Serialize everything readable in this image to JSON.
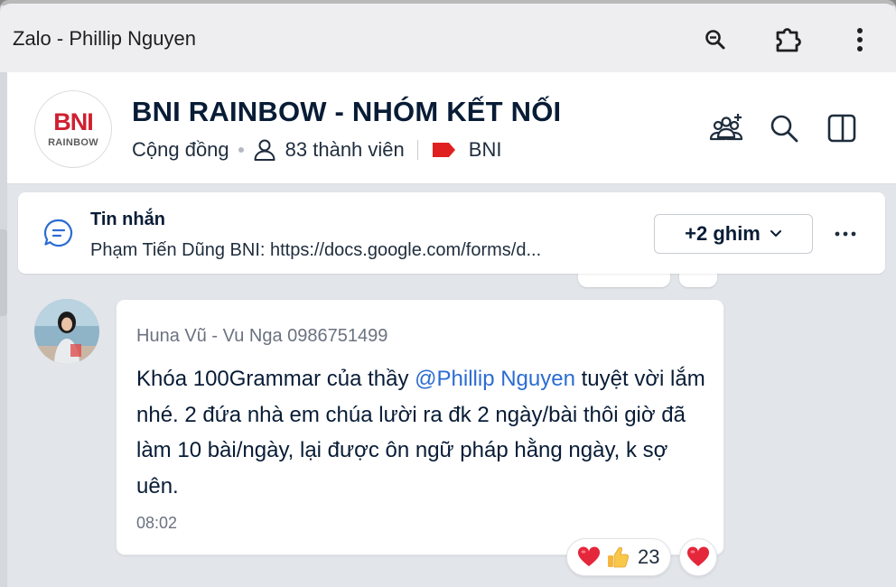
{
  "window": {
    "title": "Zalo - Phillip Nguyen",
    "zoom_icon": "zoom-out-icon",
    "extension_icon": "puzzle-icon",
    "menu_icon": "vertical-dots-icon"
  },
  "header": {
    "logo_text": "BNI",
    "logo_sub": "RAINBOW",
    "group_name": "BNI RAINBOW - NHÓM KẾT NỐI",
    "type": "Cộng đồng",
    "members": "83 thành viên",
    "tag": "BNI",
    "icons": [
      "add-member-icon",
      "search-icon",
      "sidebar-panel-icon"
    ]
  },
  "pinned": {
    "title": "Tin nhắn",
    "text": "Phạm Tiến Dũng BNI: https://docs.google.com/forms/d...",
    "more_label": "+2 ghim"
  },
  "message": {
    "sender": "Huna Vũ - Vu Nga 0986751499",
    "text_before": "Khóa 100Grammar của thầy ",
    "mention": "@Phillip Nguyen",
    "text_after": " tuyệt vời lắm nhé. 2 đứa nhà em chúa lười ra đk 2 ngày/bài thôi giờ đã làm 10 bài/ngày, lại được ôn ngữ pháp hằng ngày, k sợ uên.",
    "time": "08:02",
    "reactions": [
      "heart",
      "thumbs-up"
    ],
    "reaction_count": "23"
  },
  "colors": {
    "brand_red": "#cf2030",
    "mention_blue": "#2b6cd3",
    "title_dark": "#081c36",
    "chat_bg": "#e2e5ea"
  }
}
